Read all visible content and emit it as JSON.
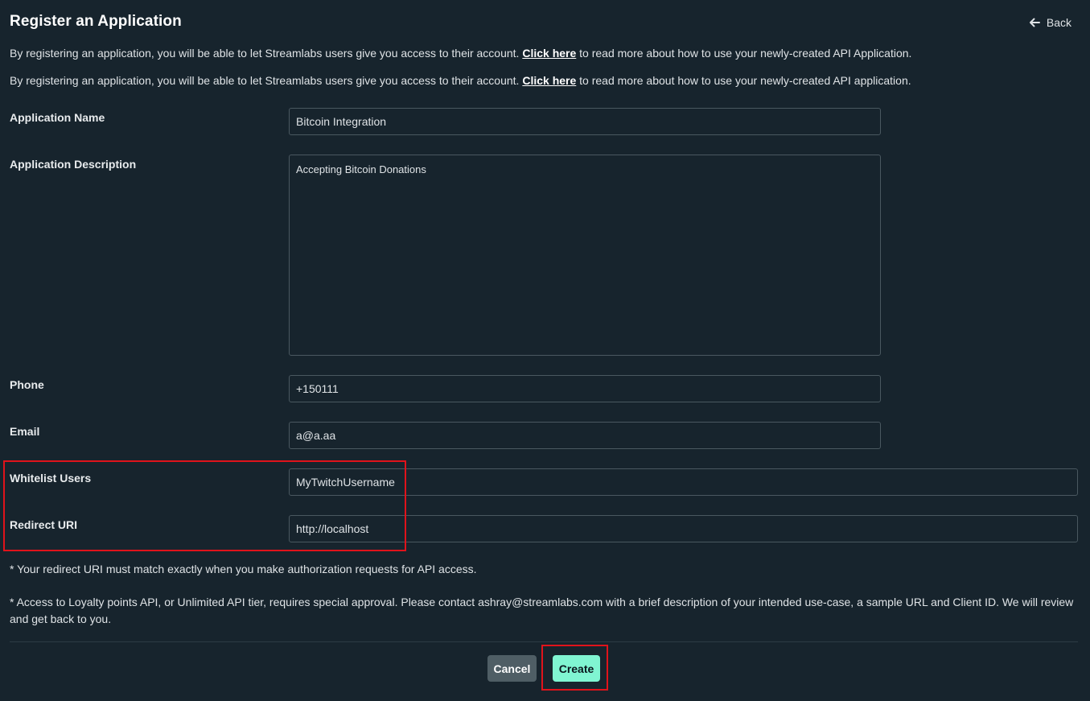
{
  "header": {
    "title": "Register an Application",
    "back_label": "Back"
  },
  "intro": [
    {
      "before": "By registering an application, you will be able to let Streamlabs users give you access to their account. ",
      "link": "Click here",
      "after": " to read more about how to use your newly-created API Application."
    },
    {
      "before": "By registering an application, you will be able to let Streamlabs users give you access to their account. ",
      "link": "Click here",
      "after": " to read more about how to use your newly-created API application."
    }
  ],
  "form": {
    "app_name": {
      "label": "Application Name",
      "value": "Bitcoin Integration"
    },
    "app_description": {
      "label": "Application Description",
      "value": "Accepting Bitcoin Donations"
    },
    "phone": {
      "label": "Phone",
      "value": "+150111"
    },
    "email": {
      "label": "Email",
      "value": "a@a.aa"
    },
    "whitelist_users": {
      "label": "Whitelist Users",
      "value": "MyTwitchUsername"
    },
    "redirect_uri": {
      "label": "Redirect URI",
      "value": "http://localhost"
    }
  },
  "notes": {
    "redirect": "* Your redirect URI must match exactly when you make authorization requests for API access.",
    "approval": "* Access to Loyalty points API, or Unlimited API tier, requires special approval. Please contact ashray@streamlabs.com with a brief description of your intended use-case, a sample URL and Client ID. We will review and get back to you."
  },
  "actions": {
    "cancel_label": "Cancel",
    "create_label": "Create"
  },
  "colors": {
    "background": "#17242d",
    "accent": "#80f5d2",
    "highlight": "#e0131b"
  }
}
